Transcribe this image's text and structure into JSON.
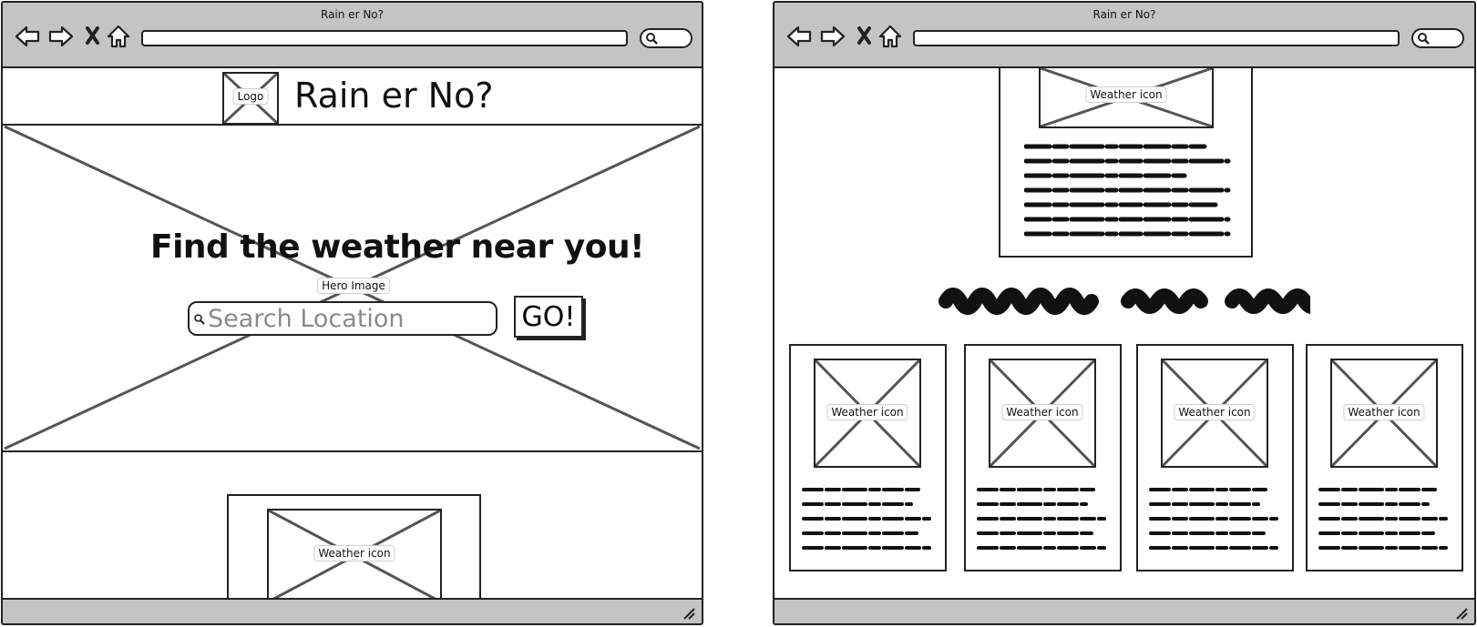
{
  "windows": [
    {
      "title": "Rain er No?"
    },
    {
      "title": "Rain er No?"
    }
  ],
  "home": {
    "logo_label": "Logo",
    "site_title": "Rain er No?",
    "hero_heading": "Find the weather near you!",
    "hero_image_label": "Hero Image",
    "search_placeholder": "Search Location",
    "go_label": "GO!",
    "current_weather_icon_label": "Weather icon"
  },
  "results": {
    "current_weather_icon_label": "Weather icon",
    "forecast_cards": [
      {
        "icon_label": "Weather icon"
      },
      {
        "icon_label": "Weather icon"
      },
      {
        "icon_label": "Weather icon"
      },
      {
        "icon_label": "Weather icon"
      }
    ]
  },
  "icons": [
    "back-arrow-icon",
    "forward-arrow-icon",
    "stop-icon",
    "home-icon",
    "search-icon",
    "resize-grip-icon"
  ],
  "colors": {
    "chrome": "#c4c4c4",
    "stroke": "#222222",
    "placeholder_text": "#8a8a8a"
  }
}
